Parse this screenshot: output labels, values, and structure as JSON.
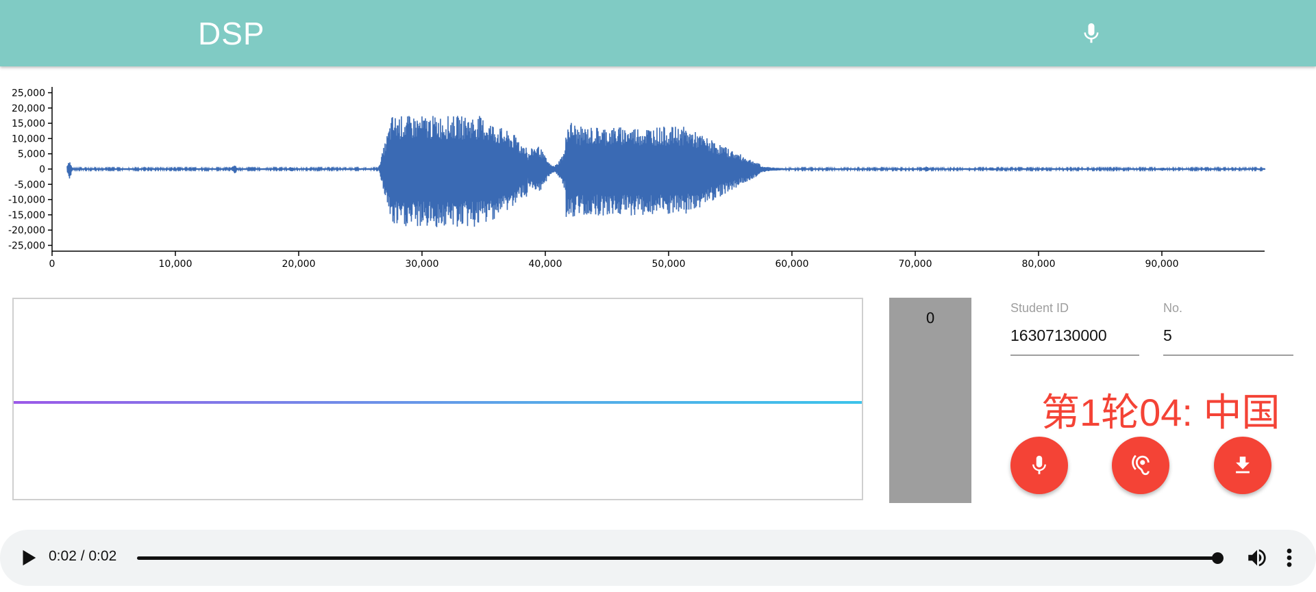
{
  "appbar": {
    "title": "DSP",
    "mic_icon": "mic-icon"
  },
  "waveform": {
    "y_ticks": [
      "25,000",
      "20,000",
      "15,000",
      "10,000",
      "5,000",
      "0",
      "-5,000",
      "-10,000",
      "-15,000",
      "-20,000",
      "-25,000"
    ],
    "x_ticks": [
      "0",
      "10,000",
      "20,000",
      "30,000",
      "40,000",
      "50,000",
      "60,000",
      "70,000",
      "80,000",
      "90,000"
    ]
  },
  "meter": {
    "value": "0"
  },
  "form": {
    "student_id_label": "Student ID",
    "student_id_value": "16307130000",
    "no_label": "No.",
    "no_value": "5"
  },
  "prompt": "第1轮04: 中国",
  "actions": [
    {
      "name": "record",
      "icon": "mic-icon"
    },
    {
      "name": "listen",
      "icon": "ear-icon"
    },
    {
      "name": "download",
      "icon": "download-icon"
    }
  ],
  "player": {
    "time": "0:02 / 0:02",
    "progress": 1.0
  },
  "colors": {
    "appbar": "#80cbc4",
    "accent": "#f44336",
    "wave": "#3a6ab4",
    "meter": "#9e9e9e"
  }
}
